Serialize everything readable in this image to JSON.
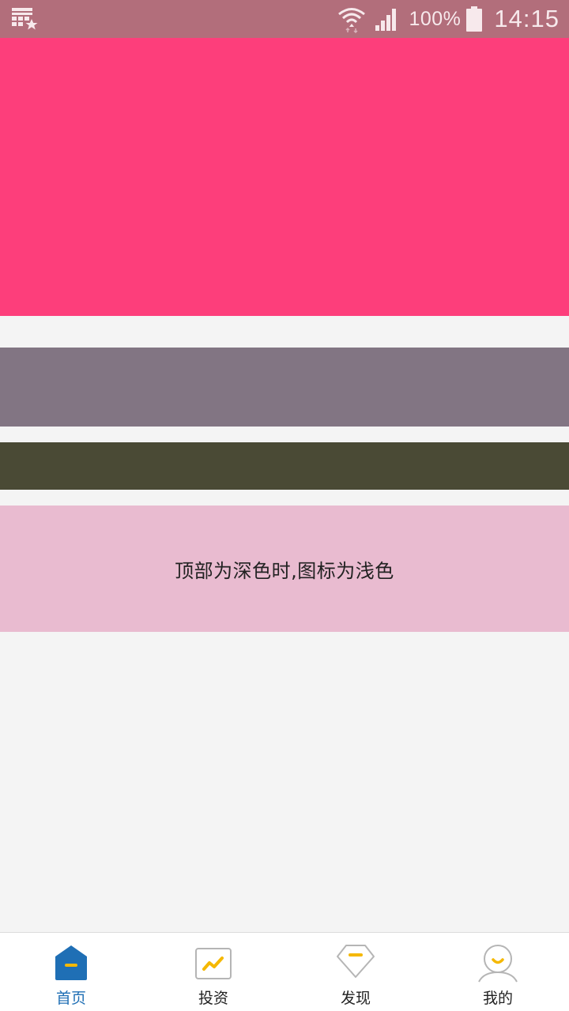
{
  "status_bar": {
    "left_icon": "calendar-star-icon",
    "battery_percent": "100%",
    "time": "14:15",
    "background_color": "#b26e7b"
  },
  "blocks": {
    "hero_color": "#fd3e7b",
    "mauve_color": "#827583",
    "olive_color": "#4a4a35",
    "pink_color": "#e9bbd0",
    "pink_text": "顶部为深色时,图标为浅色"
  },
  "bottom_nav": {
    "active_color": "#1f6fb5",
    "accent_color": "#f5b800",
    "items": [
      {
        "label": "首页",
        "icon": "home-icon",
        "active": true
      },
      {
        "label": "投资",
        "icon": "invest-chart-icon",
        "active": false
      },
      {
        "label": "发现",
        "icon": "discover-diamond-icon",
        "active": false
      },
      {
        "label": "我的",
        "icon": "profile-icon",
        "active": false
      }
    ]
  }
}
